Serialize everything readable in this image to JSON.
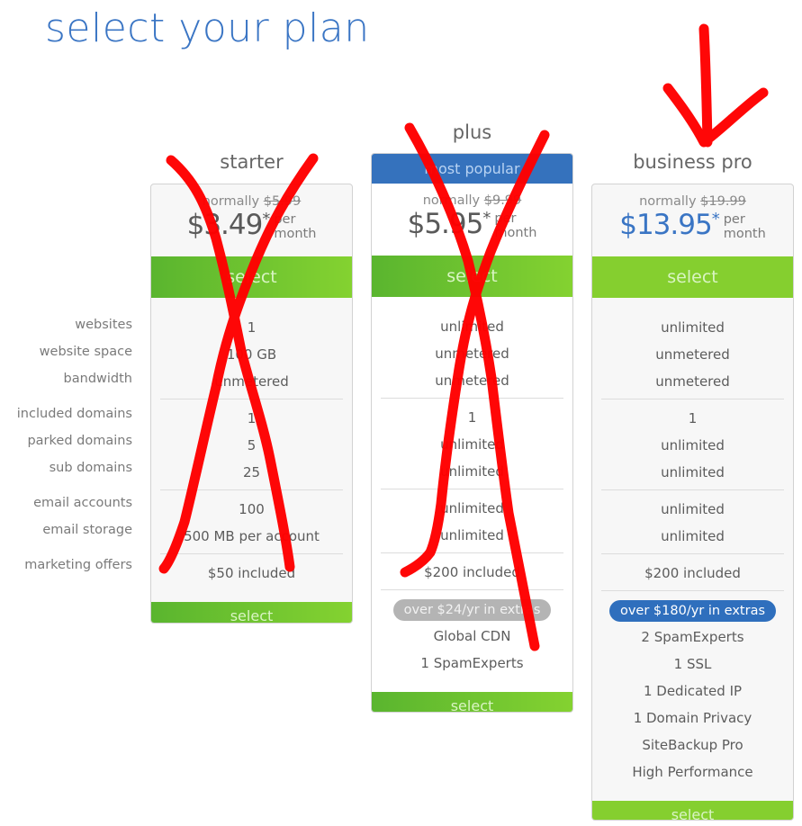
{
  "page": {
    "title": "select your plan"
  },
  "feature_labels": [
    "websites",
    "website space",
    "bandwidth",
    "included domains",
    "parked domains",
    "sub domains",
    "email accounts",
    "email storage",
    "marketing offers"
  ],
  "plans": [
    {
      "name": "starter",
      "normally_label": "normally",
      "original_price": "$5.99",
      "price": "$3.49",
      "asterisk": "*",
      "per_line1": "per",
      "per_line2": "month",
      "select_label": "select",
      "features": [
        "1",
        "100 GB",
        "unmetered",
        "1",
        "5",
        "25",
        "100",
        "500 MB per account",
        "$50 included"
      ],
      "crossed_out": true
    },
    {
      "name": "plus",
      "banner": "most popular",
      "normally_label": "normally",
      "original_price": "$9.99",
      "price": "$5.95",
      "asterisk": "*",
      "per_line1": "per",
      "per_line2": "month",
      "select_label": "select",
      "features": [
        "unlimited",
        "unmetered",
        "unmetered",
        "1",
        "unlimited",
        "unlimited",
        "unlimited",
        "unlimited",
        "$200 included"
      ],
      "extras_badge": "over $24/yr in extras",
      "extras": [
        "Global CDN",
        "1 SpamExperts"
      ],
      "crossed_out": true
    },
    {
      "name": "business pro",
      "normally_label": "normally",
      "original_price": "$19.99",
      "price": "$13.95",
      "asterisk": "*",
      "per_line1": "per",
      "per_line2": "month",
      "select_label": "select",
      "features": [
        "unlimited",
        "unmetered",
        "unmetered",
        "1",
        "unlimited",
        "unlimited",
        "unlimited",
        "unlimited",
        "$200 included"
      ],
      "extras_badge": "over $180/yr in extras",
      "extras": [
        "2 SpamExperts",
        "1 SSL",
        "1 Dedicated IP",
        "1 Domain Privacy",
        "SiteBackup Pro",
        "High Performance"
      ],
      "highlighted": true
    }
  ],
  "colors": {
    "title_blue": "#3a75c4",
    "select_green": "#84d230",
    "banner_blue": "#3572bd",
    "annotation_red": "#ff0000"
  }
}
